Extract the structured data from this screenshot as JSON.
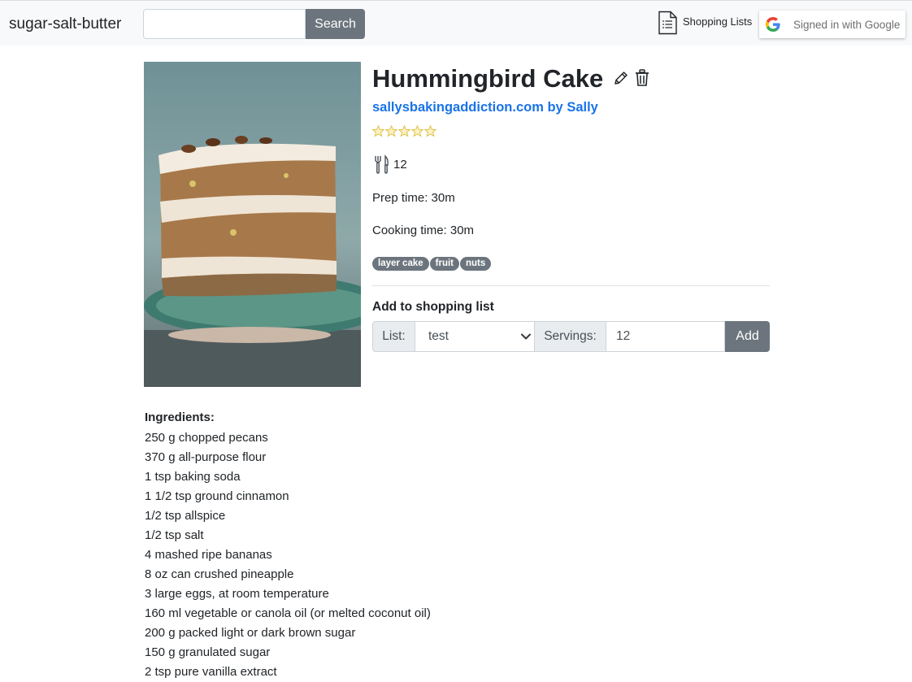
{
  "navbar": {
    "brand": "sugar-salt-butter",
    "search_placeholder": "",
    "search_button": "Search",
    "shopping_lists_label": "Shopping Lists",
    "google_label": "Signed in with Google",
    "icons": [
      "document-list-icon",
      "google-logo-icon"
    ]
  },
  "recipe": {
    "title": "Hummingbird Cake",
    "source": "sallysbakingaddiction.com by Sally",
    "rating": 0,
    "rating_max": 5,
    "servings": "12",
    "prep_time": "Prep time: 30m",
    "cooking_time": "Cooking time: 30m",
    "tags": [
      "layer cake",
      "fruit",
      "nuts"
    ],
    "icons": [
      "pencil-icon",
      "trash-icon",
      "star-icon",
      "utensils-icon"
    ]
  },
  "shopping": {
    "heading": "Add to shopping list",
    "list_label": "List:",
    "list_value": "test",
    "servings_label": "Servings:",
    "servings_value": "12",
    "add_button": "Add"
  },
  "ingredients": {
    "heading": "Ingredients:",
    "items": [
      "250 g chopped pecans",
      "370 g all-purpose flour",
      "1 tsp baking soda",
      "1 1/2 tsp ground cinnamon",
      "1/2 tsp allspice",
      "1/2 tsp salt",
      "4 mashed ripe bananas",
      "8 oz can crushed pineapple",
      "3 large eggs, at room temperature",
      "160 ml vegetable or canola oil (or melted coconut oil)",
      "200 g packed light or dark brown sugar",
      "150 g granulated sugar",
      "2 tsp pure vanilla extract"
    ]
  },
  "colors": {
    "navbar_bg": "#f8f9fa",
    "link_blue": "#1a73e8",
    "button_gray": "#6c757d",
    "star_outline": "#e0c24c"
  }
}
